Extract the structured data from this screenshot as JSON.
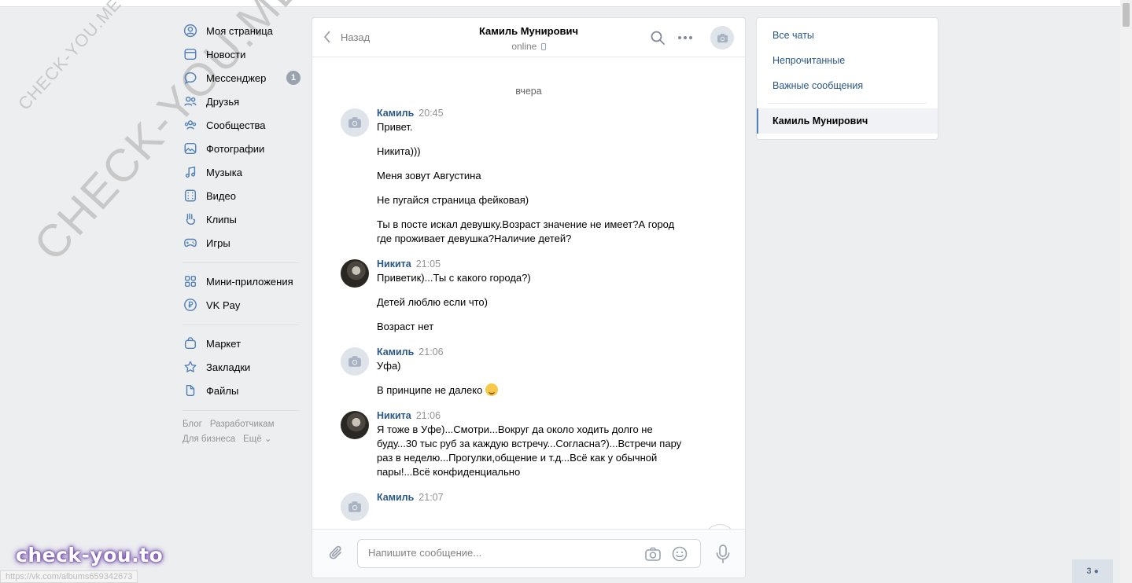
{
  "watermark": {
    "small": "CHECK-YOU.ME",
    "big": "CHECK-YOU.ME"
  },
  "nav": {
    "items": [
      {
        "label": "Моя страница",
        "icon": "user-circle-icon"
      },
      {
        "label": "Новости",
        "icon": "news-icon"
      },
      {
        "label": "Мессенджер",
        "icon": "message-icon",
        "badge": "1"
      },
      {
        "label": "Друзья",
        "icon": "friends-icon"
      },
      {
        "label": "Сообщества",
        "icon": "communities-icon"
      },
      {
        "label": "Фотографии",
        "icon": "photo-icon"
      },
      {
        "label": "Музыка",
        "icon": "music-icon"
      },
      {
        "label": "Видео",
        "icon": "video-icon"
      },
      {
        "label": "Клипы",
        "icon": "clips-icon"
      },
      {
        "label": "Игры",
        "icon": "gamepad-icon"
      }
    ],
    "items2": [
      {
        "label": "Мини-приложения",
        "icon": "apps-icon"
      },
      {
        "label": "VK Pay",
        "icon": "vkpay-icon"
      }
    ],
    "items3": [
      {
        "label": "Маркет",
        "icon": "market-icon"
      },
      {
        "label": "Закладки",
        "icon": "star-icon"
      },
      {
        "label": "Файлы",
        "icon": "file-icon"
      }
    ],
    "footer": {
      "blog": "Блог",
      "dev": "Разработчикам",
      "biz": "Для бизнеса",
      "more": "Ещё ⌄"
    }
  },
  "chat": {
    "back_label": "Назад",
    "peer_name": "Камиль Мунирович",
    "peer_status": "online",
    "date_separator": "вчера",
    "groups": [
      {
        "author": "Камиль",
        "time": "20:45",
        "avatar": "camera-placeholder",
        "messages": [
          "Привет.",
          "Никита)))",
          "Меня зовут Августина",
          "Не пугайся страница фейковая)",
          "Ты в посте искал девушку.Возраст значение не имеет?А город где проживает девушка?Наличие детей?"
        ]
      },
      {
        "author": "Никита",
        "time": "21:05",
        "avatar": "photo",
        "messages": [
          "Приветик)...Ты с какого города?)",
          "Детей люблю если что)",
          "Возраст нет"
        ]
      },
      {
        "author": "Камиль",
        "time": "21:06",
        "avatar": "camera-placeholder",
        "messages": [
          "Уфа)",
          "В принципе не далеко"
        ]
      },
      {
        "author": "Никита",
        "time": "21:06",
        "avatar": "photo",
        "messages": [
          "Я тоже в Уфе)...Смотри...Вокруг да около ходить долго не буду...30 тыс руб за каждую встречу...Согласна?)...Встречи пару раз в неделю...Прогулки,общение и т.д...Всё как у обычной пары!...Всё конфиденциально"
        ]
      },
      {
        "author": "Камиль",
        "time": "21:07",
        "avatar": "camera-placeholder",
        "messages": []
      }
    ],
    "composer_placeholder": "Напишите сообщение..."
  },
  "right": {
    "all_chats": "Все чаты",
    "unread": "Непрочитанные",
    "important": "Важные сообщения",
    "active_chat": "Камиль Мунирович"
  },
  "overlay": {
    "brand": "check-you.to",
    "status_url": "https://vk.com/albums659342673",
    "viewers": "3"
  }
}
